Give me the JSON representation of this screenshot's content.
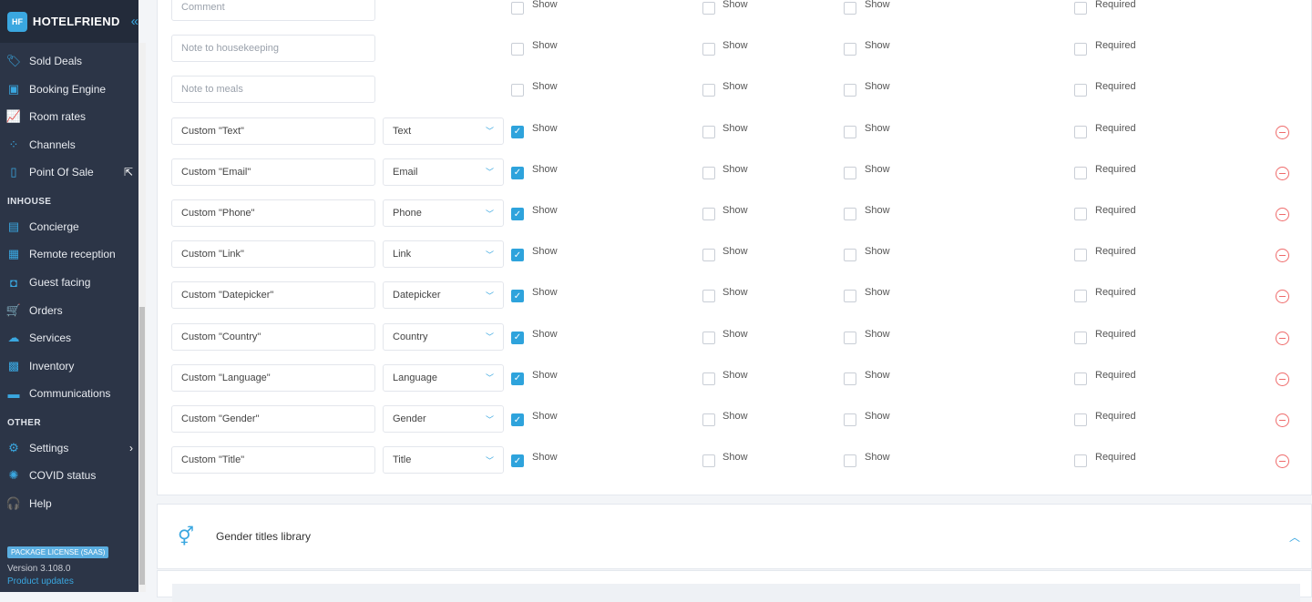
{
  "brand": {
    "name": "HOTELFRIEND",
    "logo": "HF"
  },
  "sidebar": {
    "items": [
      {
        "label": "Sold Deals",
        "icon": "tag-icon",
        "glyph": "🏷"
      },
      {
        "label": "Booking Engine",
        "icon": "booking-engine-icon",
        "glyph": "▣"
      },
      {
        "label": "Room rates",
        "icon": "chart-icon",
        "glyph": "📈"
      },
      {
        "label": "Channels",
        "icon": "channels-icon",
        "glyph": "⁘"
      },
      {
        "label": "Point Of Sale",
        "icon": "pos-terminal-icon",
        "glyph": "▯",
        "external": true
      },
      {
        "label": "Concierge",
        "icon": "concierge-icon",
        "glyph": "▤"
      },
      {
        "label": "Remote reception",
        "icon": "remote-reception-icon",
        "glyph": "▦"
      },
      {
        "label": "Guest facing",
        "icon": "guest-facing-icon",
        "glyph": "◘"
      },
      {
        "label": "Orders",
        "icon": "cart-icon",
        "glyph": "🛒"
      },
      {
        "label": "Services",
        "icon": "cloud-icon",
        "glyph": "☁"
      },
      {
        "label": "Inventory",
        "icon": "inventory-icon",
        "glyph": "▩"
      },
      {
        "label": "Communications",
        "icon": "chat-icon",
        "glyph": "▬"
      },
      {
        "label": "Settings",
        "icon": "gear-icon",
        "glyph": "⚙",
        "chevron": true
      },
      {
        "label": "COVID status",
        "icon": "virus-icon",
        "glyph": "✺"
      },
      {
        "label": "Help",
        "icon": "headset-icon",
        "glyph": "🎧"
      }
    ],
    "sections": [
      "INHOUSE",
      "OTHER"
    ],
    "license": "PACKAGE LICENSE (SAAS)",
    "version": "Version 3.108.0",
    "updates": "Product updates"
  },
  "labels": {
    "show": "Show",
    "required": "Required"
  },
  "fields": [
    {
      "name": "Comment",
      "placeholder": true,
      "type": null,
      "c": [
        false,
        false,
        false,
        false
      ],
      "removable": false
    },
    {
      "name": "Note to housekeeping",
      "placeholder": true,
      "type": null,
      "c": [
        false,
        false,
        false,
        false
      ],
      "removable": false
    },
    {
      "name": "Note to meals",
      "placeholder": true,
      "type": null,
      "c": [
        false,
        false,
        false,
        false
      ],
      "removable": false
    },
    {
      "name": "Custom \"Text\"",
      "type": "Text",
      "c": [
        true,
        false,
        false,
        false
      ],
      "removable": true
    },
    {
      "name": "Custom \"Email\"",
      "type": "Email",
      "c": [
        true,
        false,
        false,
        false
      ],
      "removable": true
    },
    {
      "name": "Custom \"Phone\"",
      "type": "Phone",
      "c": [
        true,
        false,
        false,
        false
      ],
      "removable": true
    },
    {
      "name": "Custom \"Link\"",
      "type": "Link",
      "c": [
        true,
        false,
        false,
        false
      ],
      "removable": true
    },
    {
      "name": "Custom \"Datepicker\"",
      "type": "Datepicker",
      "c": [
        true,
        false,
        false,
        false
      ],
      "removable": true
    },
    {
      "name": "Custom \"Country\"",
      "type": "Country",
      "c": [
        true,
        false,
        false,
        false
      ],
      "removable": true
    },
    {
      "name": "Custom \"Language\"",
      "type": "Language",
      "c": [
        true,
        false,
        false,
        false
      ],
      "removable": true
    },
    {
      "name": "Custom \"Gender\"",
      "type": "Gender",
      "c": [
        true,
        false,
        false,
        false
      ],
      "removable": true
    },
    {
      "name": "Custom \"Title\"",
      "type": "Title",
      "c": [
        true,
        false,
        false,
        false
      ],
      "removable": true
    }
  ],
  "gender_section": {
    "title": "Gender titles library",
    "icon": "gender-icon"
  },
  "colors": {
    "accent": "#2ea3dc",
    "sidebar": "#2c3547",
    "danger": "#ef6b6b"
  }
}
